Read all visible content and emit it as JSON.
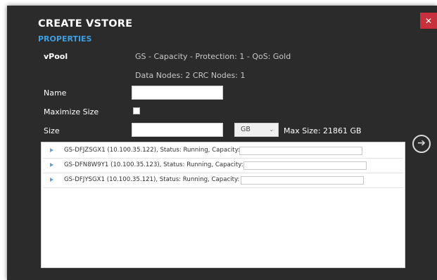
{
  "dialog": {
    "title": "CREATE VSTORE",
    "section": "PROPERTIES",
    "close_glyph": "✕",
    "next_glyph": "➔"
  },
  "form": {
    "vpool_label": "vPool",
    "vpool_value": "GS - Capacity - Protection: 1 - QoS: Gold",
    "nodes_value": "Data Nodes:  2  CRC Nodes:  1",
    "name_label": "Name",
    "name_value": "",
    "maximize_label": "Maximize Size",
    "maximize_checked": false,
    "size_label": "Size",
    "size_value": "",
    "unit_selected": "GB",
    "unit_chevron": "⌄",
    "max_size_text": "Max Size: 21861 GB"
  },
  "nodes": [
    {
      "text": "GS-DFJZSGX1 (10.100.35.122), Status:  Running, Capacity:",
      "capacity": ""
    },
    {
      "text": "GS-DFN8W9Y1 (10.100.35.123), Status:  Running, Capacity:",
      "capacity": ""
    },
    {
      "text": "GS-DFJYSGX1 (10.100.35.121), Status:  Running, Capacity:",
      "capacity": ""
    }
  ],
  "colors": {
    "dialog_bg": "#2b2b2b",
    "accent": "#3f9fde",
    "close_red": "#c7303c"
  },
  "icons": {
    "close": "close-icon",
    "next": "arrow-right-circle-icon",
    "expander": "triangle-right-icon"
  }
}
